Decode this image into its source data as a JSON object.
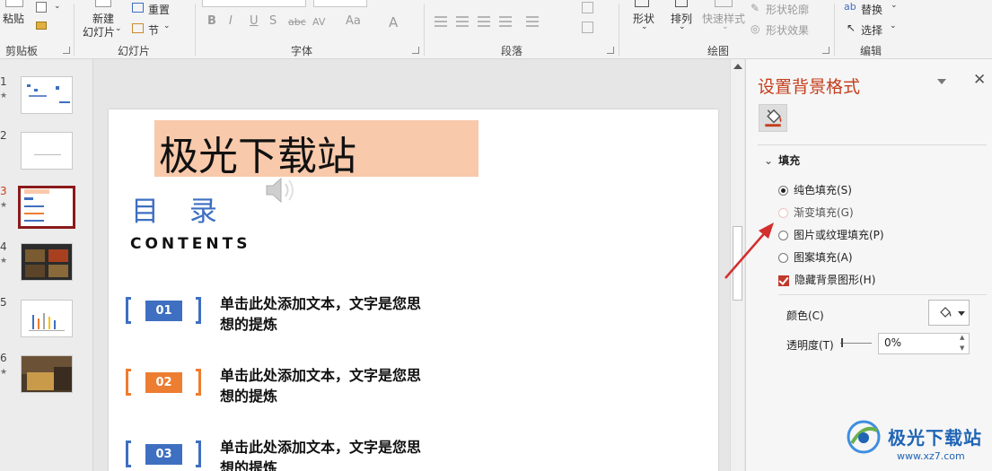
{
  "ribbon": {
    "clipboard": {
      "paste_label": "粘贴",
      "group_label": "剪贴板"
    },
    "slides": {
      "new_slide_label": "新建",
      "new_slide_label2": "幻灯片",
      "reset_label": "重置",
      "section_label": "节",
      "group_label": "幻灯片"
    },
    "font": {
      "group_label": "字体"
    },
    "paragraph": {
      "group_label": "段落"
    },
    "drawing": {
      "shape_label": "形状",
      "arrange_label": "排列",
      "quick_style_label": "快速样式",
      "shape_outline_label": "形状轮廓",
      "shape_effect_label": "形状效果",
      "group_label": "绘图"
    },
    "editing": {
      "replace_label": "替换",
      "select_label": "选择",
      "group_label": "编辑"
    }
  },
  "thumbnails": [
    {
      "number": "1",
      "star": "★"
    },
    {
      "number": "2",
      "star": ""
    },
    {
      "number": "3",
      "star": "★"
    },
    {
      "number": "4",
      "star": "★"
    },
    {
      "number": "5",
      "star": ""
    },
    {
      "number": "6",
      "star": "★"
    }
  ],
  "slide": {
    "title": "极光下载站",
    "toc_heading": "目 录",
    "contents_label": "CONTENTS",
    "items": [
      {
        "number": "01",
        "text": "单击此处添加文本，文字是您思想的提炼",
        "color": "#3e6fc0"
      },
      {
        "number": "02",
        "text": "单击此处添加文本，文字是您思想的提炼",
        "color": "#ed7d31"
      },
      {
        "number": "03",
        "text": "单击此处添加文本，文字是您思想的提炼",
        "color": "#3e6fc0"
      }
    ]
  },
  "pane": {
    "title": "设置背景格式",
    "close_symbol": "✕",
    "fill_section": "填充",
    "options": {
      "solid": "纯色填充(S)",
      "gradient": "渐变填充(G)",
      "picture": "图片或纹理填充(P)",
      "pattern": "图案填充(A)",
      "hide_bg": "隐藏背景图形(H)"
    },
    "color_label": "颜色(C)",
    "transparency_label": "透明度(T)",
    "transparency_value": "0%"
  },
  "watermark": {
    "name": "极光下载站",
    "url": "www.xz7.com"
  },
  "colors": {
    "accent": "#c43e1c",
    "blue": "#3e6fc0",
    "orange": "#ed7d31",
    "title_bg": "#f8c9ab"
  }
}
